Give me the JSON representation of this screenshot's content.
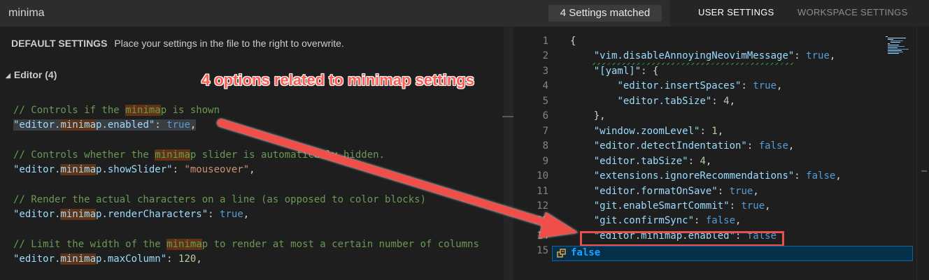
{
  "search": {
    "value": "minima"
  },
  "match_badge": "4 Settings matched",
  "tabs": [
    {
      "label": "USER SETTINGS"
    },
    {
      "label": "WORKSPACE SETTINGS"
    }
  ],
  "left": {
    "header_title": "DEFAULT SETTINGS",
    "header_desc": "Place your settings in the file to the right to overwrite.",
    "group_label": "Editor (4)",
    "settings": [
      {
        "comment_pre": "// Controls if the ",
        "comment_hl": "minima",
        "comment_post": "p is shown",
        "key_pre": "\"editor.",
        "key_hl": "minima",
        "key_post": "p.enabled\"",
        "value": "true",
        "value_type": "kw"
      },
      {
        "comment_pre": "// Controls whether the ",
        "comment_hl": "minima",
        "comment_post": "p slider is automatically hidden.",
        "key_pre": "\"editor.",
        "key_hl": "minima",
        "key_post": "p.showSlider\"",
        "value": "\"mouseover\"",
        "value_type": "str"
      },
      {
        "comment_pre": "// Render the actual characters on a line (as opposed to color blocks)",
        "comment_hl": "",
        "comment_post": "",
        "key_pre": "\"editor.",
        "key_hl": "minima",
        "key_post": "p.renderCharacters\"",
        "value": "true",
        "value_type": "kw"
      },
      {
        "comment_pre": "// Limit the width of the ",
        "comment_hl": "minima",
        "comment_post": "p to render at most a certain number of columns",
        "key_pre": "\"editor.",
        "key_hl": "minima",
        "key_post": "p.maxColumn\"",
        "value": "120",
        "value_type": "num"
      }
    ]
  },
  "right": {
    "line_numbers": [
      "1",
      "2",
      "3",
      "4",
      "5",
      "6",
      "7",
      "8",
      "9",
      "10",
      "11",
      "12",
      "13",
      "14",
      "15"
    ],
    "lines": [
      {
        "indent": "",
        "key": "",
        "value": "",
        "value_type": "pun",
        "raw": "{"
      },
      {
        "indent": "    ",
        "key": "\"vim.disableAnnoyingNeovimMessage\"",
        "value": "true",
        "value_type": "kw",
        "raw": ""
      },
      {
        "indent": "    ",
        "key": "\"[yaml]\"",
        "value": "{",
        "value_type": "pun",
        "raw": ""
      },
      {
        "indent": "        ",
        "key": "\"editor.insertSpaces\"",
        "value": "true",
        "value_type": "kw",
        "raw": ""
      },
      {
        "indent": "        ",
        "key": "\"editor.tabSize\"",
        "value": "4",
        "value_type": "num",
        "raw": ""
      },
      {
        "indent": "    ",
        "key": "",
        "value": "",
        "value_type": "pun",
        "raw": "},"
      },
      {
        "indent": "    ",
        "key": "\"window.zoomLevel\"",
        "value": "1",
        "value_type": "num",
        "raw": ""
      },
      {
        "indent": "    ",
        "key": "\"editor.detectIndentation\"",
        "value": "false",
        "value_type": "kw",
        "raw": ""
      },
      {
        "indent": "    ",
        "key": "\"editor.tabSize\"",
        "value": "4",
        "value_type": "num",
        "raw": ""
      },
      {
        "indent": "    ",
        "key": "\"extensions.ignoreRecommendations\"",
        "value": "false",
        "value_type": "kw",
        "raw": ""
      },
      {
        "indent": "    ",
        "key": "\"editor.formatOnSave\"",
        "value": "true",
        "value_type": "kw",
        "raw": ""
      },
      {
        "indent": "    ",
        "key": "\"git.enableSmartCommit\"",
        "value": "true",
        "value_type": "kw",
        "raw": ""
      },
      {
        "indent": "    ",
        "key": "\"git.confirmSync\"",
        "value": "false",
        "value_type": "kw",
        "raw": ""
      },
      {
        "indent": "    ",
        "key": "\"editor.minimap.enabled\"",
        "value": "false",
        "value_type": "kw",
        "raw": ""
      }
    ],
    "suggestion": {
      "icon": "enum-member-icon",
      "text": "false"
    }
  },
  "annotation": {
    "text": "4 options related to minimap settings",
    "color": "#ff5c54"
  },
  "colors": {
    "highlight": "#613214",
    "comment": "#6a9955",
    "key": "#9cdcfe",
    "keyword": "#569cd6",
    "string": "#ce9178",
    "number": "#b5cea8"
  }
}
